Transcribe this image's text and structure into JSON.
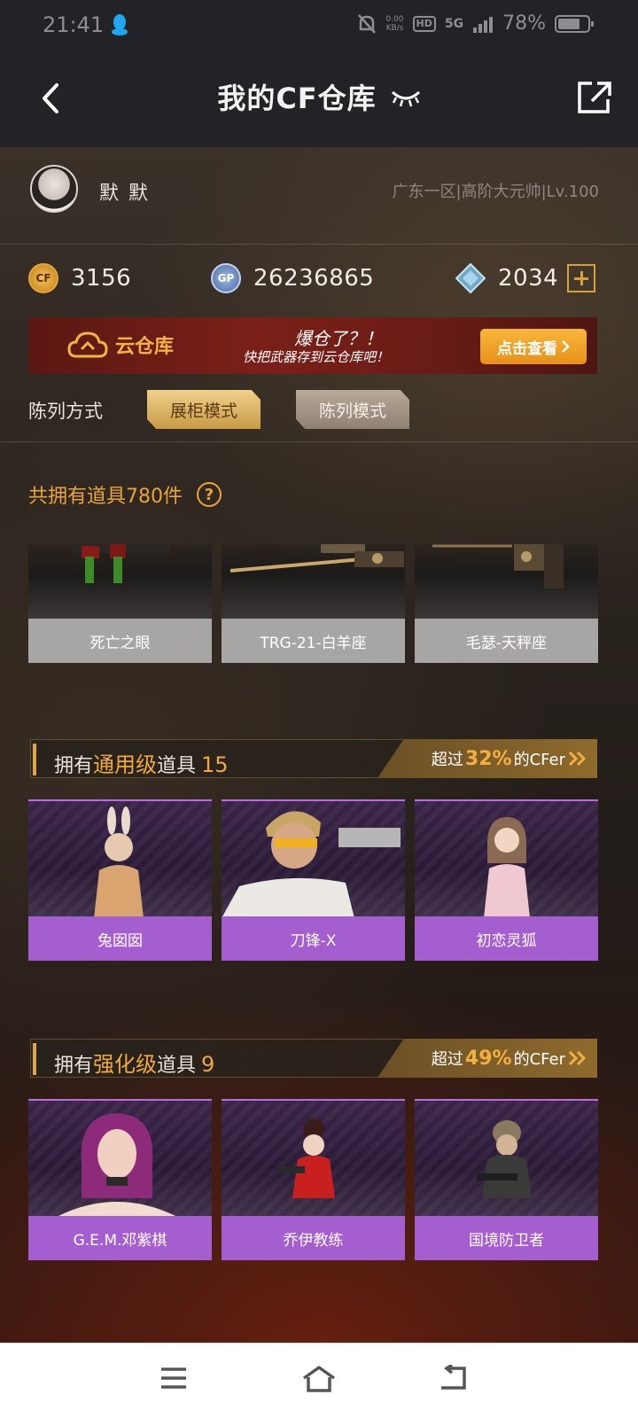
{
  "status_bar": {
    "time": "21:41",
    "net_speed_top": "0.00",
    "net_speed_bottom": "KB/s",
    "hd": "HD",
    "signal": "5G",
    "battery": "78%"
  },
  "header": {
    "title": "我的CF仓库"
  },
  "profile": {
    "username": "默 默",
    "server_info": "广东一区|高阶大元帅|Lv.100"
  },
  "currency": {
    "cf_icon_text": "CF",
    "cf_points": "3156",
    "gp_icon_text": "GP",
    "gp_points": "26236865",
    "diamonds": "2034"
  },
  "cloud_banner": {
    "logo_text": "云仓库",
    "slogan_main": "爆仓了？！",
    "slogan_sub": "快把武器存到云仓库吧！",
    "button_label": "点击查看"
  },
  "sort": {
    "label": "陈列方式",
    "mode_showcase": "展柜模式",
    "mode_display": "陈列模式"
  },
  "inventory": {
    "total_text": "共拥有道具780件",
    "help_icon_text": "?"
  },
  "weapons": [
    {
      "name": "死亡之眼"
    },
    {
      "name": "TRG-21-白羊座"
    },
    {
      "name": "毛瑟-天秤座"
    }
  ],
  "section_general": {
    "prefix": "拥有",
    "highlight": "通用级",
    "suffix": "道具",
    "count": "15",
    "exceed_prefix": "超过",
    "exceed_pct": "32%",
    "exceed_suffix": "的CFer",
    "items": [
      {
        "name": "兔囡囡"
      },
      {
        "name": "刀锋-X"
      },
      {
        "name": "初恋灵狐"
      }
    ]
  },
  "section_enhanced": {
    "prefix": "拥有",
    "highlight": "强化级",
    "suffix": "道具",
    "count": "9",
    "exceed_prefix": "超过",
    "exceed_pct": "49%",
    "exceed_suffix": "的CFer",
    "items": [
      {
        "name": "G.E.M.邓紫棋"
      },
      {
        "name": "乔伊教练"
      },
      {
        "name": "国境防卫者"
      }
    ]
  },
  "colors": {
    "accent": "#eaa43a",
    "purple_label": "#a55ecf",
    "header_bg": "#232327"
  },
  "icons": {
    "back": "back-arrow-icon",
    "eye": "eye-closed-icon",
    "share": "share-icon",
    "menu": "menu-icon",
    "home": "home-icon",
    "return": "return-icon"
  }
}
